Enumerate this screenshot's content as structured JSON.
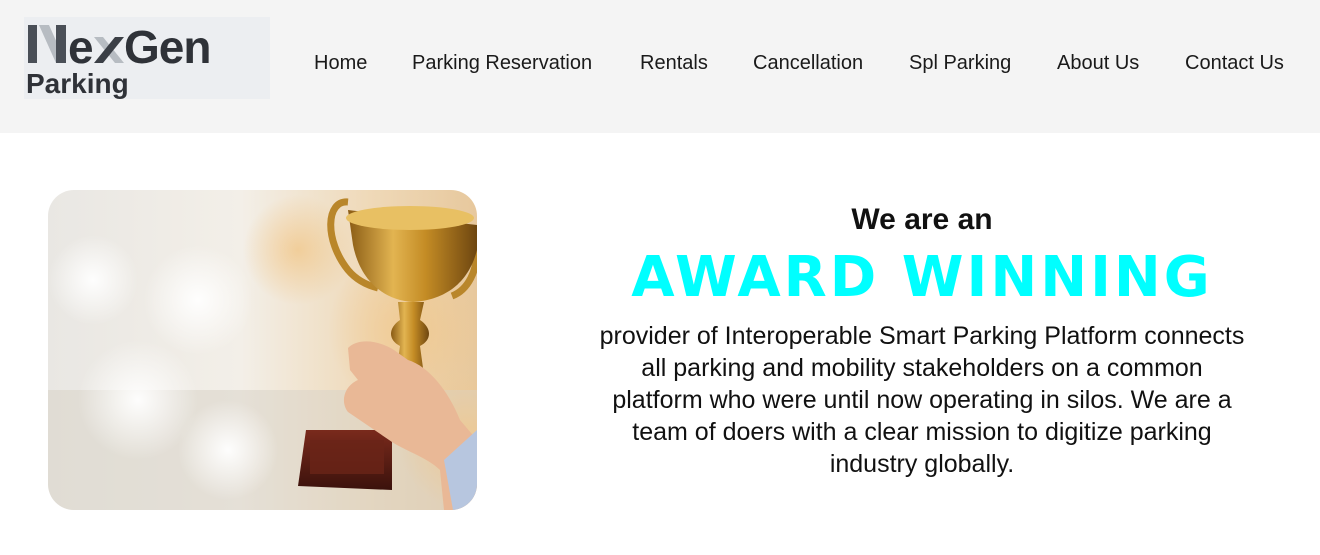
{
  "logo": {
    "brand_top": "NexGen",
    "brand_bottom": "Parking"
  },
  "nav": {
    "items": [
      {
        "label": "Home"
      },
      {
        "label": "Parking Reservation"
      },
      {
        "label": "Rentals"
      },
      {
        "label": "Cancellation"
      },
      {
        "label": "Spl Parking"
      },
      {
        "label": "About Us"
      },
      {
        "label": "Contact Us"
      }
    ]
  },
  "hero": {
    "image_icon": "trophy-photo",
    "intro": "We are an",
    "highlight": "AWARD WINNING",
    "description": "provider of Interoperable Smart Parking Platform connects all parking and mobility stakeholders on a common platform who were until now operating in silos. We are a team of doers with a clear mission to digitize parking industry globally."
  },
  "colors": {
    "header_bg": "#f4f4f4",
    "highlight": "#00ffff",
    "text": "#111111",
    "trophy_gold": "#c9962e"
  }
}
